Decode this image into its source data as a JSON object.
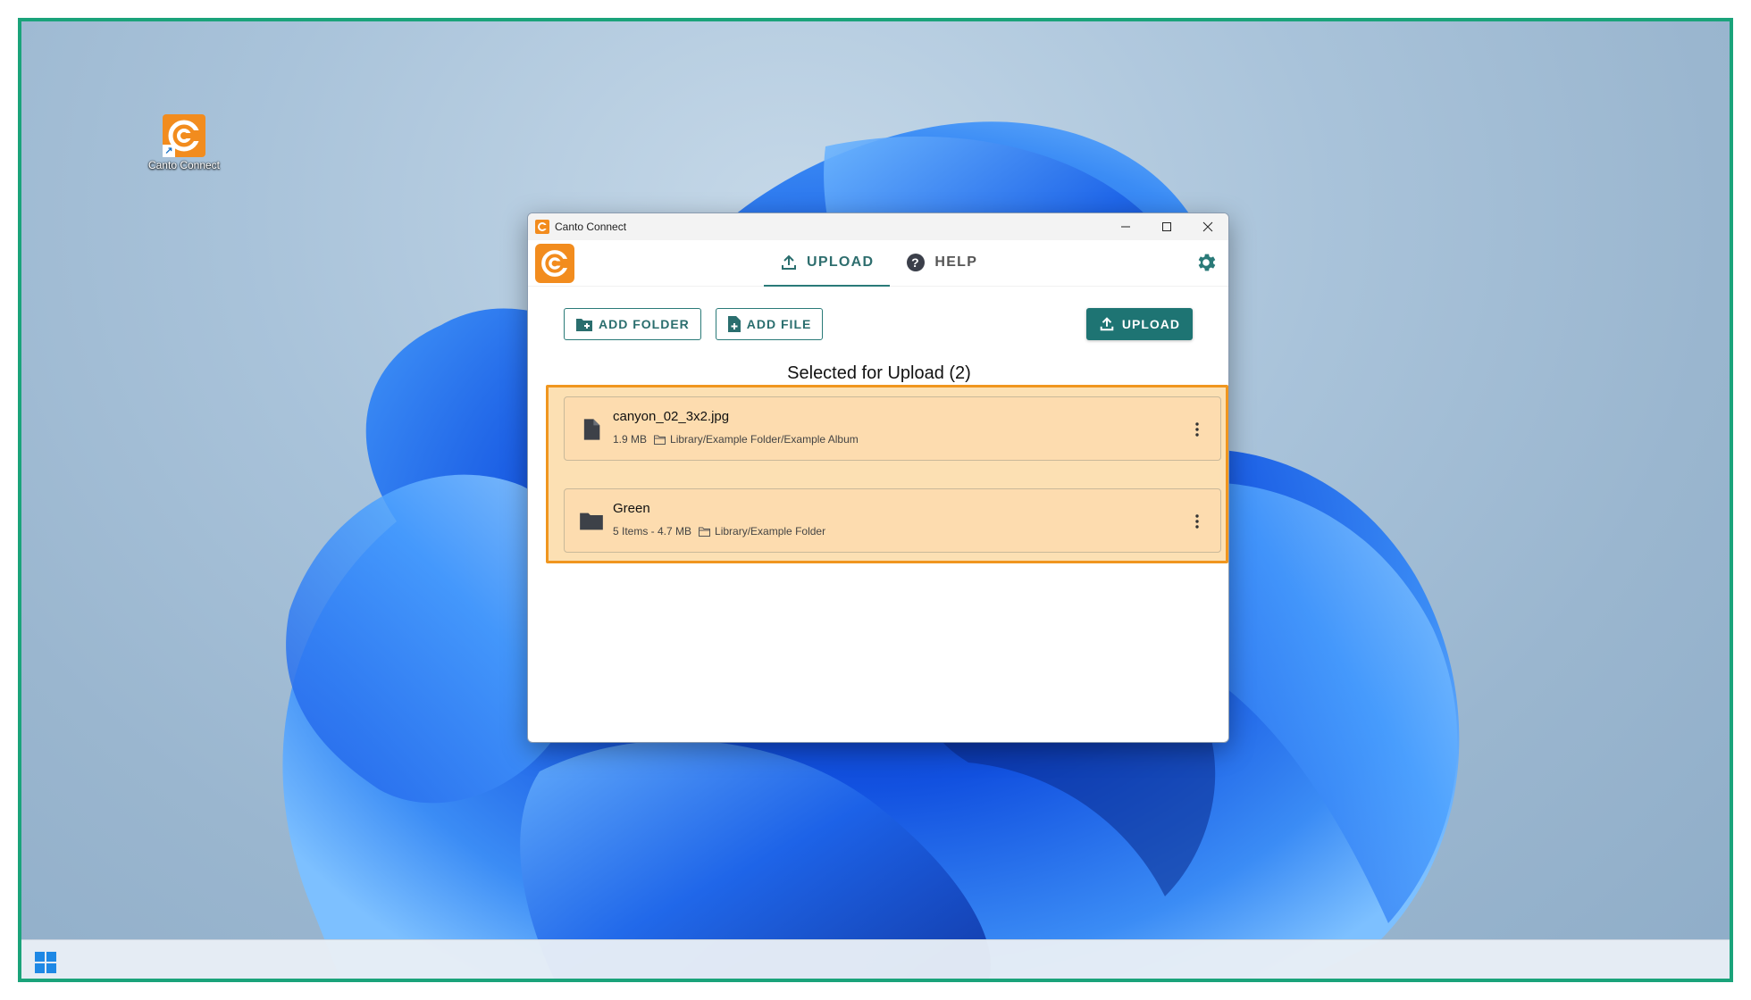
{
  "desktop": {
    "shortcut_label": "Canto Connect"
  },
  "window": {
    "title": "Canto Connect",
    "controls": {
      "minimize": "minimize",
      "maximize": "maximize",
      "close": "close"
    }
  },
  "header": {
    "tabs": [
      {
        "label": "UPLOAD",
        "icon": "upload-icon",
        "active": true
      },
      {
        "label": "HELP",
        "icon": "help-circle-icon",
        "active": false
      }
    ],
    "settings_icon": "gear-icon"
  },
  "actions": {
    "add_folder": "ADD FOLDER",
    "add_file": "ADD FILE",
    "upload": "UPLOAD"
  },
  "selection": {
    "title": "Selected for Upload (2)",
    "items": [
      {
        "type": "file",
        "icon": "file-icon",
        "name": "canyon_02_3x2.jpg",
        "size": "1.9 MB",
        "destination": "Library/Example Folder/Example Album"
      },
      {
        "type": "folder",
        "icon": "folder-icon",
        "name": "Green",
        "size": "5 Items - 4.7 MB",
        "destination": "Library/Example Folder"
      }
    ]
  },
  "colors": {
    "accent": "#1e7473",
    "brand": "#f28c1e",
    "highlight_border": "#f0961f",
    "highlight_fill": "#fce0b3",
    "frame_border": "#1aa37a"
  }
}
